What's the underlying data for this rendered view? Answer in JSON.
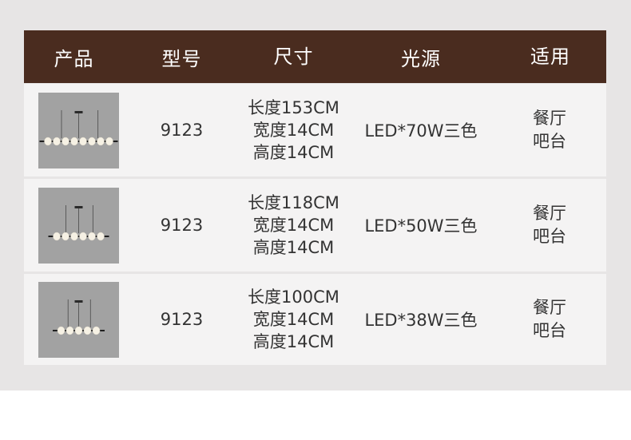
{
  "header": {
    "product": "产品",
    "model": "型号",
    "size": "尺寸",
    "light_source": "光源",
    "usage": "适用"
  },
  "rows": [
    {
      "model": "9123",
      "size": [
        "长度153CM",
        "宽度14CM",
        "高度14CM"
      ],
      "light_source": "LED*70W三色",
      "usage": [
        "餐厅",
        "吧台"
      ],
      "bulbs": 8
    },
    {
      "model": "9123",
      "size": [
        "长度118CM",
        "宽度14CM",
        "高度14CM"
      ],
      "light_source": "LED*50W三色",
      "usage": [
        "餐厅",
        "吧台"
      ],
      "bulbs": 6
    },
    {
      "model": "9123",
      "size": [
        "长度100CM",
        "宽度14CM",
        "高度14CM"
      ],
      "light_source": "LED*38W三色",
      "usage": [
        "餐厅",
        "吧台"
      ],
      "bulbs": 5
    }
  ],
  "colors": {
    "header_bg": "#4a2c1f",
    "row_bg": "#f4f3f3",
    "page_bg": "#e7e5e5"
  }
}
